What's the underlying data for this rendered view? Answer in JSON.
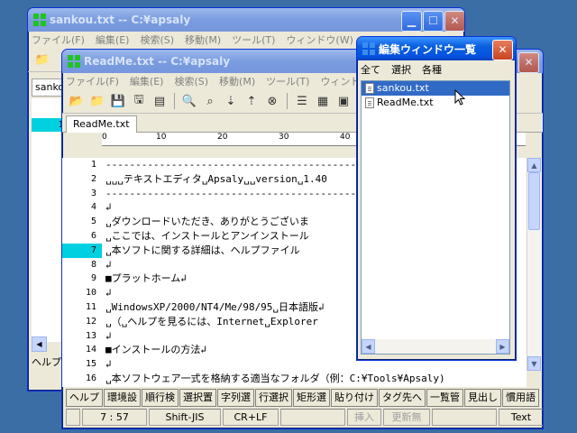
{
  "back_window": {
    "title": "sankou.txt -- C:¥apsaly",
    "menu": [
      "ファイル(F)",
      "編集(E)",
      "検索(S)",
      "移動(M)",
      "ツール(T)",
      "ウィンドウ(W)"
    ],
    "tab_label": "sanko",
    "status_label": "ヘルプ",
    "line_number": "1"
  },
  "front_window": {
    "title": "ReadMe.txt -- C:¥apsaly",
    "menu": [
      "ファイル(F)",
      "編集(E)",
      "検索(S)",
      "移動(M)",
      "ツール(T)",
      "ウィンド"
    ],
    "tab_label": "ReadMe.txt",
    "ruler": [
      "0",
      "10",
      "20",
      "30",
      "40"
    ],
    "line_numbers": [
      "1",
      "2",
      "3",
      "4",
      "5",
      "6",
      "7",
      "8",
      "9",
      "10",
      "11",
      "12",
      "13",
      "14",
      "15",
      "16"
    ],
    "lines": [
      "---------------------------------------------",
      "␣␣␣テキストエディタ␣Apsaly␣␣version␣1.40",
      "---------------------------------------------",
      "↲",
      "␣ダウンロードいただき、ありがとうございま",
      "␣ここでは、インストールとアンインストール",
      "␣本ソフトに関する詳細は、ヘルプファイル",
      "↲",
      "■プラットホーム↲",
      "↲",
      "␣WindowsXP/2000/NT4/Me/98/95␣日本語版↲",
      "␣（␣ヘルプを見るには、Internet␣Explorer",
      "↲",
      "■インストールの方法↲",
      "↲",
      "␣本ソフトウェア一式を格納する適当なフォルダ（例：C:¥Tools¥Apsaly)"
    ],
    "current_line": "7",
    "function_keys": [
      "ヘルプ",
      "環境設",
      "順行検",
      "選択置",
      "字列選",
      "行選択",
      "矩形選",
      "貼り付け",
      "タグ先へ",
      "一覧管",
      "見出し",
      "慣用語"
    ],
    "status": {
      "position": "7 : 57",
      "encoding": "Shift-JIS",
      "newline": "CR+LF",
      "insert": "挿入",
      "modified": "更新無",
      "mode": "Text"
    }
  },
  "popup": {
    "title": "編集ウィンドウ一覧",
    "menu": [
      "全て",
      "選択",
      "各種"
    ],
    "items": [
      "sankou.txt",
      "ReadMe.txt"
    ],
    "selected_index": 0
  },
  "colors": {
    "titlebar_active": "#0a5fdf",
    "current_line_highlight": "#00d0e0",
    "desktop": "#3a6ea5"
  }
}
